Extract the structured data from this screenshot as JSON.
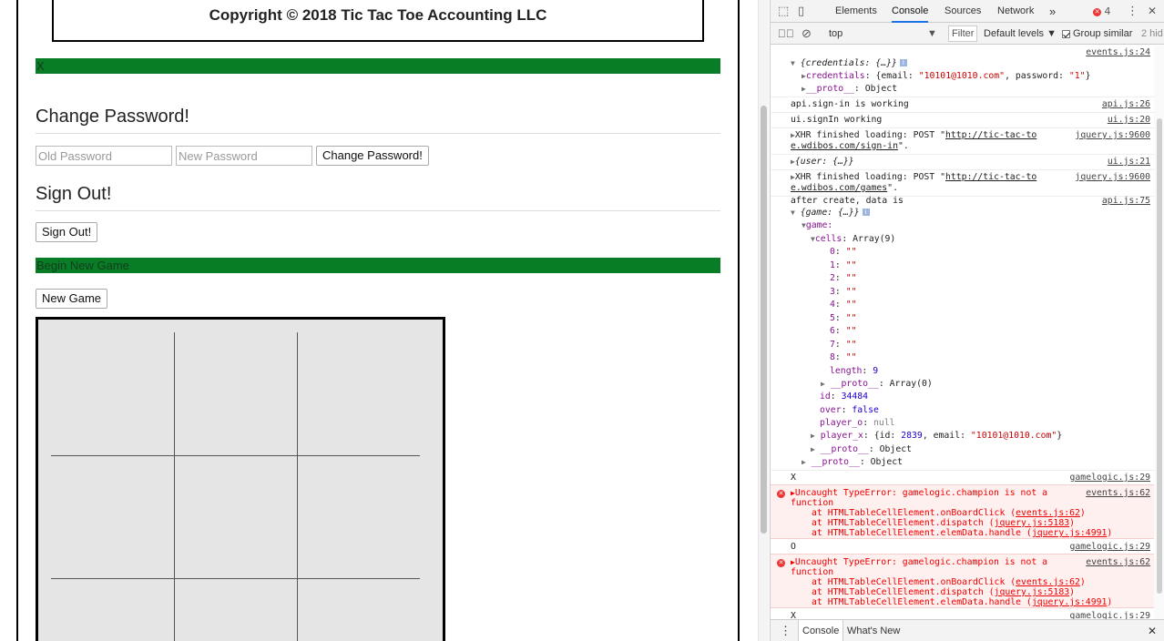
{
  "app": {
    "copyright": "Copyright © 2018 Tic Tac Toe Accounting LLC",
    "status_bar": "X",
    "change_password": {
      "title": "Change Password!",
      "old_placeholder": "Old Password",
      "new_placeholder": "New Password",
      "button": "Change Password!"
    },
    "sign_out": {
      "title": "Sign Out!",
      "button": "Sign Out!"
    },
    "game_bar": "Begin New Game",
    "new_game_button": "New Game",
    "board_color": "#e5e5e5",
    "accent_green": "#087d25"
  },
  "devtools": {
    "tabs": [
      "Elements",
      "Console",
      "Sources",
      "Network"
    ],
    "more_tabs": "»",
    "error_count": "4",
    "menu": "⋮",
    "close": "✕",
    "toolbar": {
      "context": "top",
      "filter": "Filter",
      "levels": "Default levels ▼",
      "group_similar": "Group similar",
      "hidden": "2 hid"
    },
    "log": {
      "src_events24": "events.js:24",
      "credentials_head": "{credentials: {…}}",
      "credentials_key": "credentials",
      "credentials_val_a": "{email: ",
      "credentials_email": "\"10101@1010.com\"",
      "credentials_val_b": ", password: ",
      "credentials_pw": "\"1\"",
      "credentials_val_c": "}",
      "proto_key": "__proto__",
      "proto_object": ": Object",
      "signin_msg": "api.sign-in is working",
      "src_api26": "api.js:26",
      "ui_signin_msg": "ui.signIn working",
      "src_ui20": "ui.js:20",
      "xhr1_a": "XHR finished loading: POST \"",
      "xhr1_url_a": "http://tic-tac-to",
      "xhr1_url_b": "e.wdibos.com/sign-in",
      "xhr_end": "\".",
      "src_jq9600": "jquery.js:9600",
      "user_obj": "{user: {…}}",
      "src_ui21": "ui.js:21",
      "xhr2_url_b": "e.wdibos.com/games",
      "after_create": "after create, data is",
      "src_api75": "api.js:75",
      "game_head": "{game: {…}}",
      "game_key": "game:",
      "cells_key": "cells",
      "cells_val": ": Array(9)",
      "cells": [
        "0",
        "1",
        "2",
        "3",
        "4",
        "5",
        "6",
        "7",
        "8"
      ],
      "empty_str": "\"\"",
      "length_key": "length",
      "length_val": "9",
      "array_proto": ": Array(0)",
      "id_key": "id",
      "id_val": "34484",
      "over_key": "over",
      "over_val": "false",
      "player_o_key": "player_o",
      "player_o_val": "null",
      "player_x_key": "player_x",
      "player_x_a": ": {id: ",
      "player_x_id": "2839",
      "player_x_b": ", email: ",
      "player_x_c": "}",
      "log_x": "X",
      "log_o": "O",
      "src_gamelogic29": "gamelogic.js:29",
      "err_msg_a": "Uncaught TypeError: gamelogic.champion is not a",
      "err_msg_b": "function",
      "err_at1_a": "at HTMLTableCellElement.onBoardClick (",
      "err_at1_src": "events.js:62",
      "err_at2_a": "at HTMLTableCellElement.dispatch (",
      "err_at2_src": "jquery.js:5183",
      "err_at3_a": "at HTMLTableCellElement.elemData.handle (",
      "err_at3_src": "jquery.js:4991",
      "err_close": ")",
      "src_events62": "events.js:62"
    },
    "drawer": [
      "Console",
      "What's New"
    ]
  }
}
